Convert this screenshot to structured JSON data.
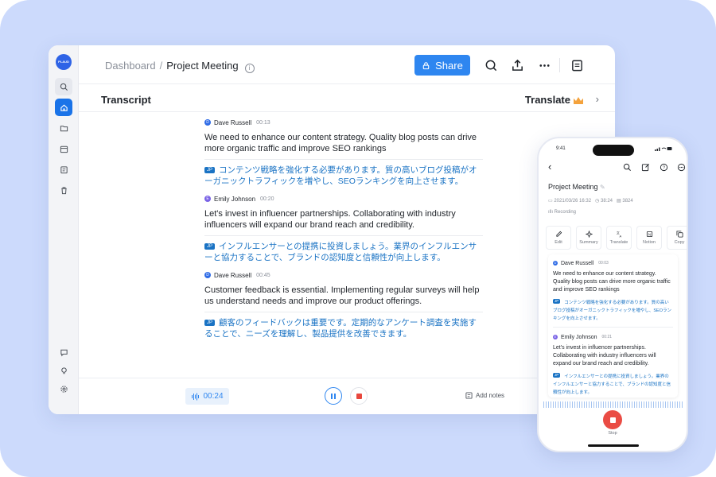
{
  "desktop": {
    "logo_text": "PLAUD",
    "breadcrumb": {
      "root": "Dashboard",
      "separator": "/",
      "current": "Project Meeting"
    },
    "share_label": "Share",
    "subbar": {
      "title": "Transcript",
      "translate": "Translate"
    },
    "entries": [
      {
        "speaker": "Dave Russell",
        "initial": "D",
        "time": "00:13",
        "text": "We need to enhance our content strategy. Quality blog posts can drive more organic traffic and improve SEO rankings",
        "lang": "JP",
        "translation": "コンテンツ戦略を強化する必要があります。質の高いブログ投稿がオーガニックトラフィックを増やし、SEOランキングを向上させます。"
      },
      {
        "speaker": "Emily Johnson",
        "initial": "E",
        "time": "00:20",
        "text": "Let's invest in influencer partnerships. Collaborating with industry influencers will expand our brand reach and credibility.",
        "lang": "JP",
        "translation": "インフルエンサーとの提携に投資しましょう。業界のインフルエンサーと協力することで、ブランドの認知度と信頼性が向上します。"
      },
      {
        "speaker": "Dave Russell",
        "initial": "D",
        "time": "00:45",
        "text": "Customer feedback is essential. Implementing regular surveys will help us understand needs and improve our product offerings.",
        "lang": "JP",
        "translation": "顧客のフィードバックは重要です。定期的なアンケート調査を実施することで、ニーズを理解し、製品提供を改善できます。"
      }
    ],
    "bottom": {
      "timer": "00:24",
      "add_notes": "Add notes"
    }
  },
  "phone": {
    "status_time": "9:41",
    "title": "Project Meeting",
    "meta": {
      "date": "2021/03/26 16:32",
      "duration": "38:24",
      "words": "3824"
    },
    "recording": "Recording",
    "tools": [
      "Edit",
      "Summary",
      "Translate",
      "Notion",
      "Copy"
    ],
    "entries": [
      {
        "speaker": "Dave Russell",
        "initial": "D",
        "time": "00:03",
        "text": "We need to enhance our content strategy. Quality blog posts can drive more organic traffic and improve SEO rankings",
        "lang": "JP",
        "translation": "コンテンツ戦略を強化する必要があります。質の高いブログ投稿がオーガニックトラフィックを増やし、SEOランキングを向上させます。"
      },
      {
        "speaker": "Emily Johnson",
        "initial": "E",
        "time": "00:21",
        "text": "Let's invest in influencer partnerships. Collaborating with industry influencers will expand our brand reach and credibility.",
        "lang": "JP",
        "translation": "インフルエンサーとの提携に投資しましょう。業界のインフルエンサーと協力することで、ブランドの認知度と信頼性が向上します。"
      }
    ],
    "stop_label": "Stop"
  },
  "colors": {
    "accent": "#2e86f0",
    "stop": "#ea4c44",
    "translation": "#1a73c4",
    "background": "#ccdafc"
  }
}
